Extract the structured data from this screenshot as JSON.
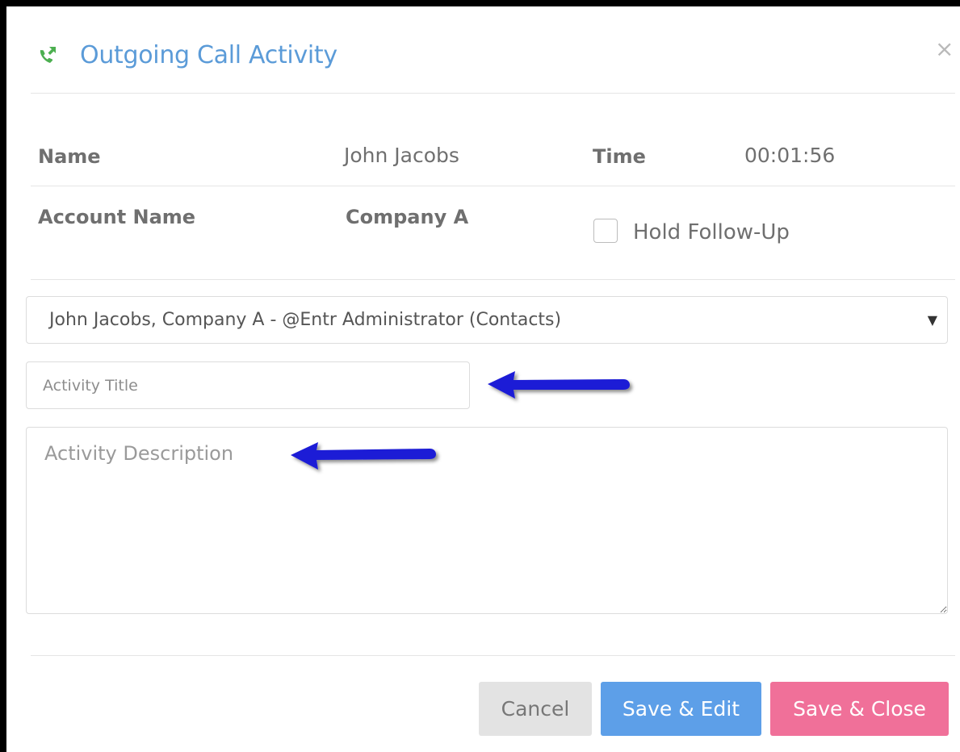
{
  "modal": {
    "title": "Outgoing Call Activity",
    "header_icon": "phone-outgoing-icon",
    "close_icon": "close-icon",
    "close_glyph": "×",
    "accent_color": "#5b9bd8",
    "icon_color": "#4caf50"
  },
  "details": {
    "name_label": "Name",
    "name_value": "John Jacobs",
    "time_label": "Time",
    "time_value": "00:01:56",
    "account_label": "Account Name",
    "account_value": "Company A",
    "hold_followup_label": "Hold Follow-Up",
    "hold_followup_checked": false
  },
  "contact_select": {
    "selected": "John Jacobs, Company A - @Entr Administrator (Contacts)",
    "caret_glyph": "▼"
  },
  "form": {
    "title_placeholder": "Activity Title",
    "description_placeholder": "Activity Description"
  },
  "annotations": {
    "arrow_color": "#1f1fd6",
    "arrow_icon": "left-arrow-icon"
  },
  "buttons": {
    "cancel": "Cancel",
    "save_edit": "Save & Edit",
    "save_close": "Save & Close",
    "save_edit_color": "#5d9fe8",
    "save_close_color": "#f07099"
  }
}
